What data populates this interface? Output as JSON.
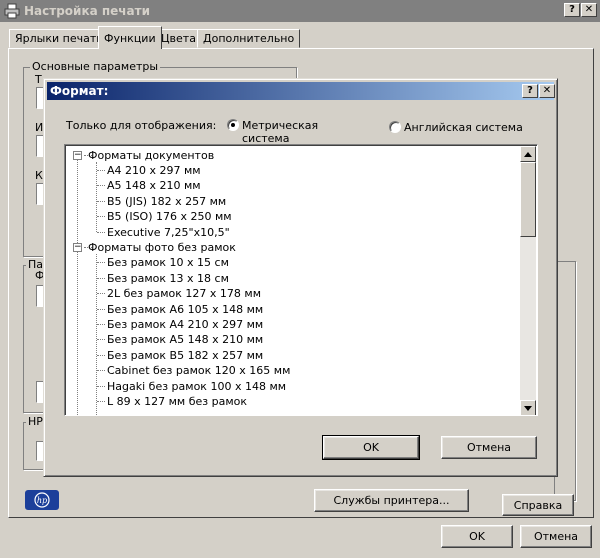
{
  "window": {
    "title": "Настройка печати",
    "help_button": "?",
    "close_button": "✕"
  },
  "tabs": [
    "Ярлыки печати",
    "Функции",
    "Цвета",
    "Дополнительно"
  ],
  "groups": {
    "basic": "Основные параметры"
  },
  "bottom": {
    "printer_services": "Службы принтера...",
    "help": "Справка",
    "ok": "OK",
    "cancel": "Отмена"
  },
  "dialog": {
    "title": "Формат:",
    "help_button": "?",
    "close_button": "✕",
    "display_label": "Только для отображения:",
    "radio_metric": "Метрическая система",
    "radio_english": "Английская система",
    "selected_unit": "metric",
    "tree": {
      "groups": [
        {
          "label": "Форматы документов",
          "items": [
            "A4 210 x 297 мм",
            "A5 148 x 210 мм",
            "B5 (JIS) 182 x 257 мм",
            "B5 (ISO) 176 x 250 мм",
            "Executive 7,25\"x10,5\""
          ]
        },
        {
          "label": "Форматы фото без рамок",
          "items": [
            "Без рамок 10 x 15 см",
            "Без рамок 13 x 18 см",
            "2L без рамок 127 x 178 мм",
            "Без рамок A6 105 x 148 мм",
            "Без рамок A4 210 x 297 мм",
            "Без рамок A5 148 x 210 мм",
            "Без рамок B5 182 x 257 мм",
            "Cabinet без рамок 120 x 165 мм",
            "Hagaki без рамок 100 x 148 мм",
            "L 89 x 127 мм без рамок"
          ]
        }
      ]
    },
    "ok": "OK",
    "cancel": "Отмена"
  },
  "fragments": {
    "f1": "Т",
    "f2": "И",
    "f3": "К",
    "f4": "Па",
    "f5": "Ф",
    "f6": "HP"
  },
  "colors": {
    "title_active": "#0a246a",
    "title_inactive": "#808080",
    "face": "#d4d0c8"
  }
}
